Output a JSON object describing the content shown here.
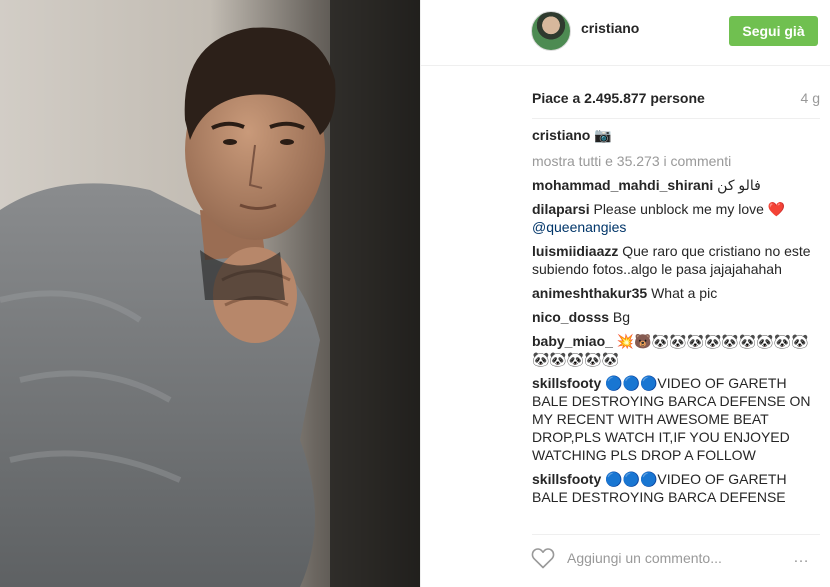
{
  "post": {
    "username": "cristiano",
    "follow_label": "Segui già",
    "likes": "Piace a 2.495.877 persone",
    "time": "4 g",
    "caption": {
      "user": "cristiano",
      "text": "📷"
    },
    "view_all": "mostra tutti e 35.273 i commenti",
    "comments": [
      {
        "user": "mohammad_mahdi_shirani",
        "text": "فالو کن"
      },
      {
        "user": "dilaparsi",
        "text": "Please unblock me my love ❤️",
        "mention": "@queenangies"
      },
      {
        "user": "luismiidiaazz",
        "text": "Que raro que cristiano no este subiendo fotos..algo le pasa jajajahahah"
      },
      {
        "user": "animeshthakur35",
        "text": "What a pic"
      },
      {
        "user": "nico_dosss",
        "text": "Bg"
      },
      {
        "user": "baby_miao_",
        "text": "💥🐻🐼🐼🐼🐼🐼🐼🐼🐼🐼🐼🐼🐼🐼🐼"
      },
      {
        "user": "skillsfooty",
        "text": "🔵🔵🔵VIDEO OF GARETH BALE DESTROYING BARCA DEFENSE ON MY RECENT WITH AWESOME BEAT DROP,PLS WATCH IT,IF YOU ENJOYED WATCHING PLS DROP A FOLLOW"
      },
      {
        "user": "skillsfooty",
        "text": "🔵🔵🔵VIDEO OF GARETH BALE DESTROYING BARCA DEFENSE"
      }
    ],
    "comment_placeholder": "Aggiungi un commento...",
    "more_icon": "…"
  },
  "colors": {
    "follow": "#70c050",
    "mention": "#003569",
    "muted": "#999999"
  },
  "icons": [
    "heart-icon",
    "more-options-icon",
    "camera-emoji"
  ]
}
